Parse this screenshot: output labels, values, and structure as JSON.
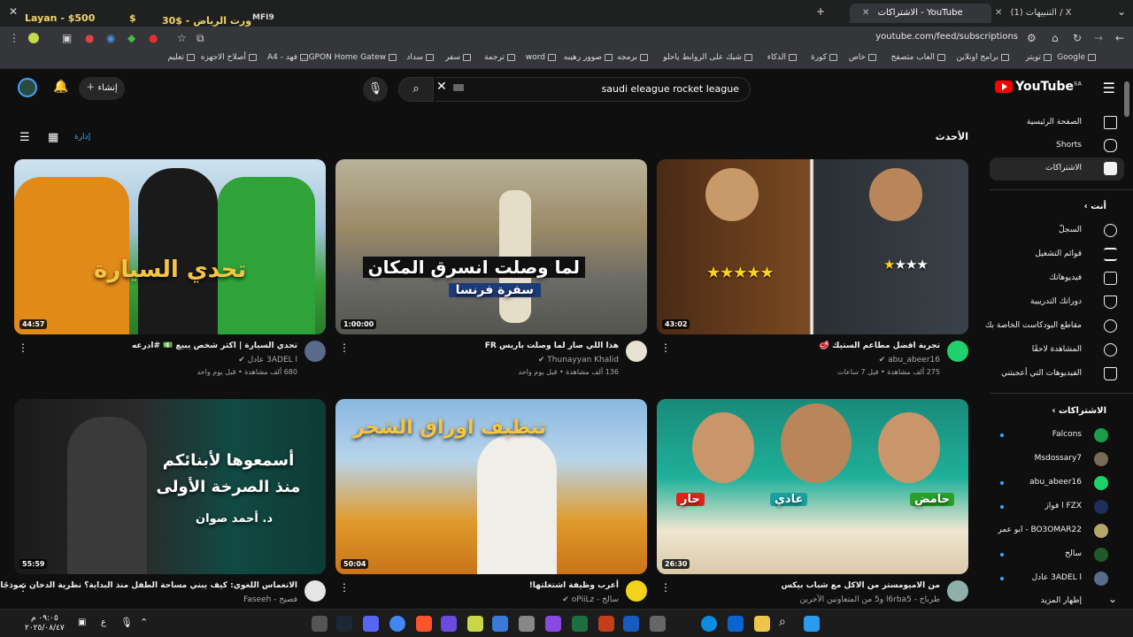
{
  "browser": {
    "tabs": [
      {
        "label": "(1) التنبيهات / X",
        "active": false
      },
      {
        "label": "الاشتراكات - YouTube",
        "active": true
      }
    ],
    "overlay_left": "Layan - $500",
    "overlay_mid": "30$ - ورت الرياض",
    "overlay_right": "MFI9",
    "url": "youtube.com/feed/subscriptions",
    "bookmarks": [
      "Google",
      "تويتر",
      "برامج اونلاين",
      "العاب متصفح",
      "خاص",
      "كورة",
      "الذكاء",
      "شيك على الروابط ياحلو",
      "برمجه",
      "صوور رهيبه",
      "word",
      "ترجمة",
      "سفر",
      "سداد",
      "GPON Home Gatew...",
      "فهد - A4",
      "أصلاح الاجهزه",
      "تعليم"
    ]
  },
  "yt": {
    "logo": "YouTube",
    "logo_sup": "SA",
    "search_value": "saudi eleague rocket league",
    "create_label": "إنشاء",
    "feed_title": "الأحدث",
    "manage_label": "إدارة"
  },
  "sidebar": {
    "main": [
      {
        "label": "الصفحة الرئيسية",
        "icon": "home-icon"
      },
      {
        "label": "Shorts",
        "icon": "shorts-icon"
      },
      {
        "label": "الاشتراكات",
        "icon": "subscriptions-icon",
        "active": true
      }
    ],
    "you_heading": "أنت",
    "you": [
      {
        "label": "السجلّ",
        "icon": "history-icon"
      },
      {
        "label": "قوائم التشغيل",
        "icon": "playlists-icon"
      },
      {
        "label": "فيديوهاتك",
        "icon": "your-videos-icon"
      },
      {
        "label": "دوراتك التدريبية",
        "icon": "courses-icon"
      },
      {
        "label": "مقاطع البودكاست الخاصة بك",
        "icon": "podcasts-icon"
      },
      {
        "label": "المشاهدة لاحقًا",
        "icon": "watch-later-icon"
      },
      {
        "label": "الفيديوهات التي أعجبتني",
        "icon": "liked-icon"
      }
    ],
    "subs_heading": "الاشتراكات",
    "subs": [
      {
        "label": "Falcons",
        "color": "#1a9e45"
      },
      {
        "label": "Msdossary7",
        "color": "#7a6a55"
      },
      {
        "label": "abu_abeer16",
        "color": "#1fd16b"
      },
      {
        "label": "FZX ا فواز",
        "color": "#1f2d5a"
      },
      {
        "label": "BO3OMAR22 - ابو عمر",
        "color": "#b7a66a"
      },
      {
        "label": "سالخ",
        "color": "#1f5a2a"
      },
      {
        "label": "3ADEL l عادل",
        "color": "#5a6a8a"
      },
      {
        "label": "إظهار المزيد",
        "color": ""
      }
    ]
  },
  "videos": [
    {
      "title": "تجربة افضل مطاعم الستيك 🥩",
      "channel": "abu_abeer16 ✔",
      "meta": "275 ألف مشاهدة • قبل 7 ساعات",
      "duration": "43:02",
      "thumb_text": "",
      "thumb_bg": "linear-gradient(90deg,#4a2a15 0%,#7a4a22 49%,#fff 49.5%,#fff 50%,#2a2f33 50.5%,#3a4148 100%)",
      "avatar": "#1fd16b"
    },
    {
      "title": "هذا اللي صار لما وصلت باريس FR",
      "channel": "Thunayyan Khalid ✔",
      "meta": "136 ألف مشاهدة • قبل يوم واحد",
      "duration": "1:00:00",
      "thumb_text": "لما وصلت انسرق المكان",
      "thumb_sub": "سفرة فرنسا",
      "thumb_bg": "linear-gradient(180deg,#b9b29a 0%,#8a7a5a 40%,#6a6a66 70%,#55554f 100%)",
      "avatar": "#e8e0d0"
    },
    {
      "title": "تحدي السيارة | اكثر شخص يبيع 💵 #ادرعه",
      "channel": "3ADEL l عادل ✔",
      "meta": "680 ألف مشاهدة • قبل يوم واحد",
      "duration": "44:57",
      "thumb_text": "تحدي السيارة",
      "thumb_bg": "linear-gradient(180deg,#cfe3ef 0%,#9fc2d8 40%,#3aa03a 70%,#2a7a2a 100%)",
      "avatar": "#5a6a8a"
    },
    {
      "title": "من الاميومستر من الاكل مع شباب بيكس",
      "channel": "طرباخ - l6rba5 و5 من المتعاونين الآخرين",
      "meta": "",
      "duration": "26:30",
      "thumb_text": "",
      "thumb_labels": [
        "حار",
        "عادي",
        "حامض"
      ],
      "thumb_bg": "linear-gradient(180deg,#1a8a7a 0%,#1fb09a 45%,#f0e6d0 75%,#d9c9a8 100%)",
      "avatar": "#8fb0a8"
    },
    {
      "title": "أعرب وظيفة اشتغلتها!",
      "channel": "سالخ - oPiiLz ✔",
      "meta": "",
      "duration": "50:04",
      "thumb_text": "تنظيف اوراق الشجر",
      "thumb_bg": "linear-gradient(180deg,#8ab8e0 0%,#b8d4ea 35%,#e09a2a 70%,#c8741a 100%)",
      "avatar": "#f2d21a"
    },
    {
      "title": "الانغماس اللغوي: كيف يبني مساحة الطفل منذ البداية؟ نظرية الدخان نموذجًا",
      "channel": "فصيح - Faseeh",
      "meta": "",
      "duration": "55:59",
      "thumb_text": "أسمعوها لأبنائكم منذ الصرخة الأولى",
      "thumb_sub": "د. أحمد صوان",
      "thumb_bg": "linear-gradient(90deg,#1a1a1a 0%,#2a2a2a 40%,#114a44 70%,#0f3a35 100%)",
      "avatar": "#e6e6e6"
    }
  ],
  "taskbar": {
    "time": "٠٩:٠٥ م",
    "date": "٢٠٢٥/٠٨/٤٧",
    "lang": "ع"
  }
}
